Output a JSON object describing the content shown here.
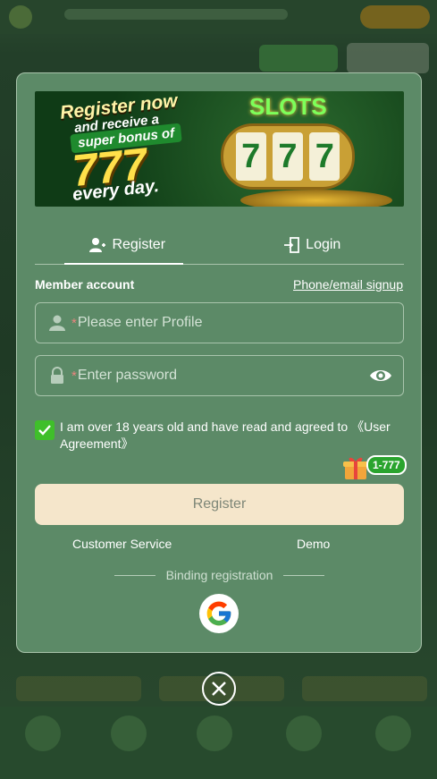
{
  "banner": {
    "line1": "Register now",
    "line2": "and receive a",
    "line3": "super bonus of",
    "line4": "777",
    "line5": "every day.",
    "slots_label": "SLOTS",
    "reels": [
      "7",
      "7",
      "7"
    ]
  },
  "tabs": [
    {
      "label": "Register",
      "icon": "add-user-icon",
      "active": true
    },
    {
      "label": "Login",
      "icon": "login-door-icon",
      "active": false
    }
  ],
  "form": {
    "member_label": "Member account",
    "alt_signup_link": "Phone/email signup",
    "required_mark": "*",
    "profile_placeholder": "Please enter Profile",
    "password_placeholder": "Enter password",
    "agree_text": "I am over 18 years old and have read and agreed to 《User Agreement》",
    "agree_checked": true
  },
  "gift_badge": "1-777",
  "register_button": "Register",
  "links": {
    "customer_service": "Customer Service",
    "demo": "Demo"
  },
  "binding_label": "Binding registration",
  "social": {
    "google_icon": "google-icon",
    "google_letter": "G"
  },
  "colors": {
    "modal_bg": "#5c8a67",
    "accent_green": "#3fbf2a",
    "button_bg": "#f5e6cb",
    "required_star": "#e9847e"
  }
}
